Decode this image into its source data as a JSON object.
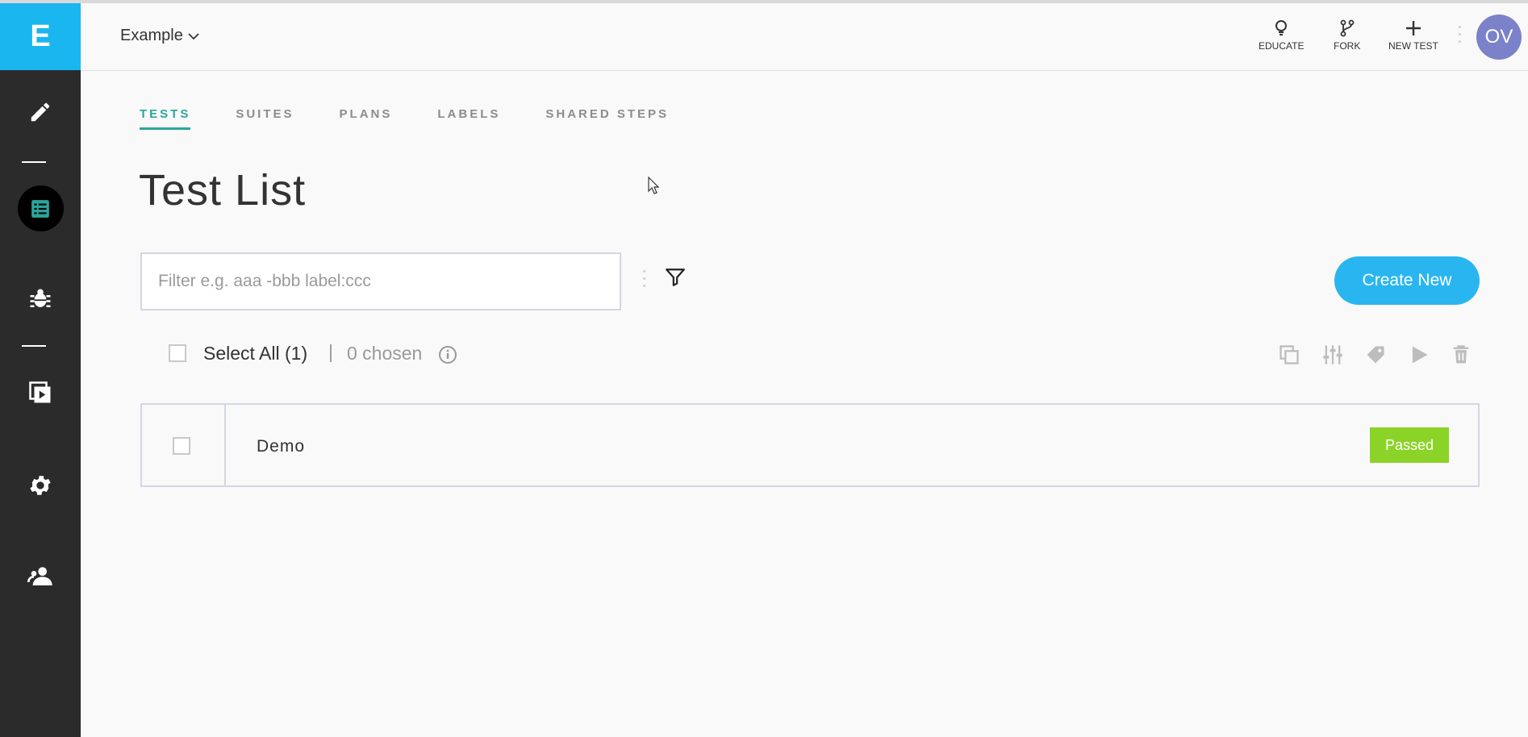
{
  "app": {
    "logo_letter": "E"
  },
  "header": {
    "project": "Example",
    "actions": [
      {
        "label": "EDUCATE",
        "icon": "lightbulb-icon"
      },
      {
        "label": "FORK",
        "icon": "fork-icon"
      },
      {
        "label": "NEW TEST",
        "icon": "plus-icon"
      }
    ],
    "avatar_initials": "OV"
  },
  "sidebar": {
    "items": [
      {
        "name": "pencil-icon"
      },
      {
        "name": "test-list-icon",
        "active": true
      },
      {
        "name": "bug-icon"
      },
      {
        "name": "suite-run-icon"
      },
      {
        "name": "gear-icon"
      },
      {
        "name": "team-icon"
      }
    ]
  },
  "tabs": [
    {
      "label": "TESTS",
      "active": true
    },
    {
      "label": "SUITES"
    },
    {
      "label": "PLANS"
    },
    {
      "label": "LABELS"
    },
    {
      "label": "SHARED STEPS"
    }
  ],
  "page": {
    "title": "Test List",
    "filter_placeholder": "Filter e.g. aaa -bbb label:ccc",
    "filter_value": "",
    "create_label": "Create New",
    "select_all": "Select All (1)",
    "separator": "|",
    "chosen": "0 chosen"
  },
  "tests": [
    {
      "name": "Demo",
      "status": "Passed"
    }
  ],
  "colors": {
    "accent": "#1ab6f0",
    "tab_active": "#2aa69b",
    "passed": "#8bd327",
    "avatar": "#7b82c9",
    "sidebar": "#2b2b2b"
  }
}
